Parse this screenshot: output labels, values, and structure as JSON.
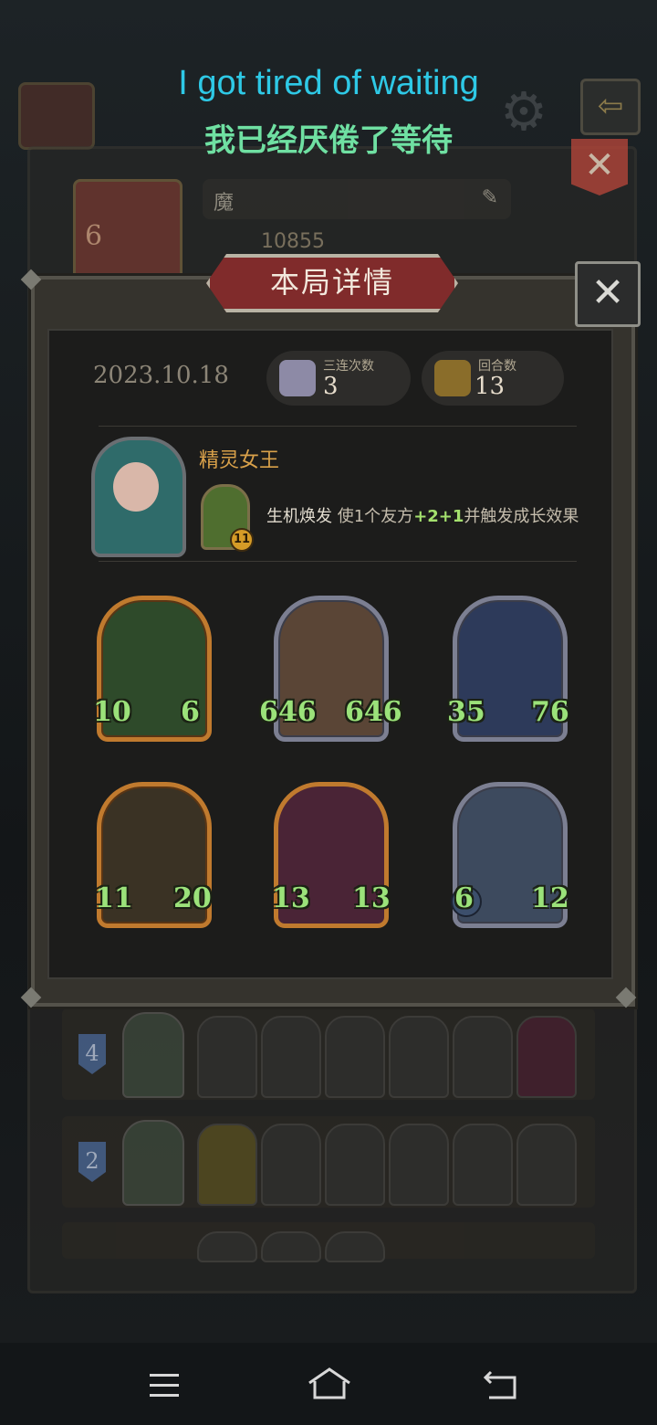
{
  "subtitles": {
    "en": "I got tired of waiting",
    "zh": "我已经厌倦了等待"
  },
  "background": {
    "player_name": "魔",
    "player_score": "10855",
    "player_level": "6",
    "lineup_rows": [
      {
        "tier": "4"
      },
      {
        "tier": "2"
      },
      {
        "tier": ""
      }
    ]
  },
  "modal": {
    "title": "本局详情",
    "close_glyph": "✕",
    "date": "2023.10.18",
    "stats": [
      {
        "label": "三连次数",
        "value": "3",
        "icon": "triple-icon"
      },
      {
        "label": "回合数",
        "value": "13",
        "icon": "rounds-icon"
      }
    ],
    "hero": {
      "name": "精灵女王",
      "skill_level": "11",
      "skill_name": "生机焕发",
      "skill_desc_pre": "使1个友方",
      "skill_desc_bonus": "+2+1",
      "skill_desc_post": "并触发成长效果"
    },
    "units": [
      {
        "atk": "10",
        "hp": "6",
        "frame": "gold"
      },
      {
        "atk": "646",
        "hp": "646",
        "frame": "silver"
      },
      {
        "atk": "35",
        "hp": "76",
        "frame": "silver"
      },
      {
        "atk": "11",
        "hp": "20",
        "frame": "gold"
      },
      {
        "atk": "13",
        "hp": "13",
        "frame": "fancy"
      },
      {
        "atk": "6",
        "hp": "12",
        "frame": "silver"
      }
    ]
  },
  "colors": {
    "stat_green": "#9be27a",
    "hero_name": "#d9a14a",
    "title_banner": "#802b2b"
  },
  "navbar": [
    "menu-icon",
    "home-icon",
    "back-icon"
  ]
}
